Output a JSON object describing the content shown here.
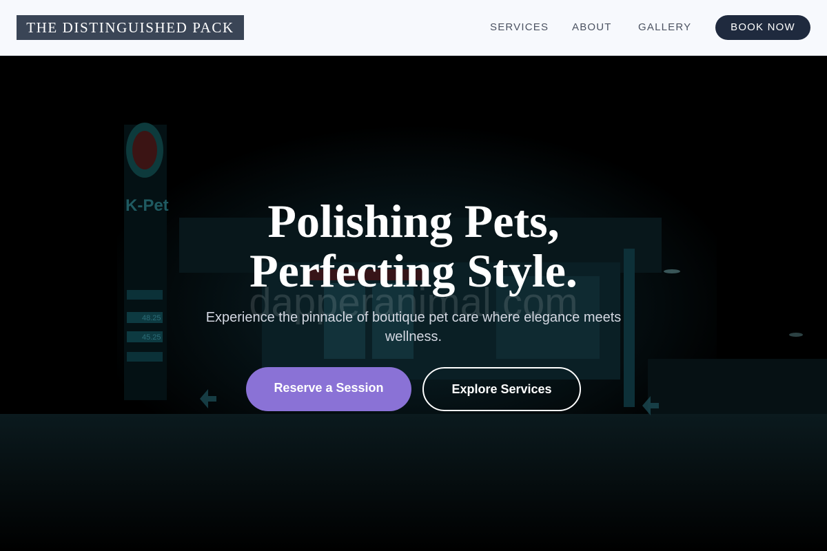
{
  "header": {
    "brand": "THE DISTINGUISHED PACK",
    "nav": {
      "services": "SERVICES",
      "about": "ABOUT",
      "gallery": "GALLERY"
    },
    "book_now": "BOOK NOW"
  },
  "hero": {
    "headline_line1": "Polishing Pets,",
    "headline_line2": "Perfecting Style.",
    "subtitle": "Experience the pinnacle of boutique pet care where elegance meets wellness.",
    "primary_cta": "Reserve a Session",
    "secondary_cta": "Explore Services",
    "background_image": {
      "sign_text": "K-Pet",
      "watermark": "dapperanimal.com",
      "price_readouts": [
        "48.25",
        "45.25"
      ]
    }
  },
  "colors": {
    "brand_bg": "#3a4556",
    "book_btn": "#1f2a3e",
    "primary_cta": "#8a72d6",
    "header_bg": "#f7f9fd"
  }
}
